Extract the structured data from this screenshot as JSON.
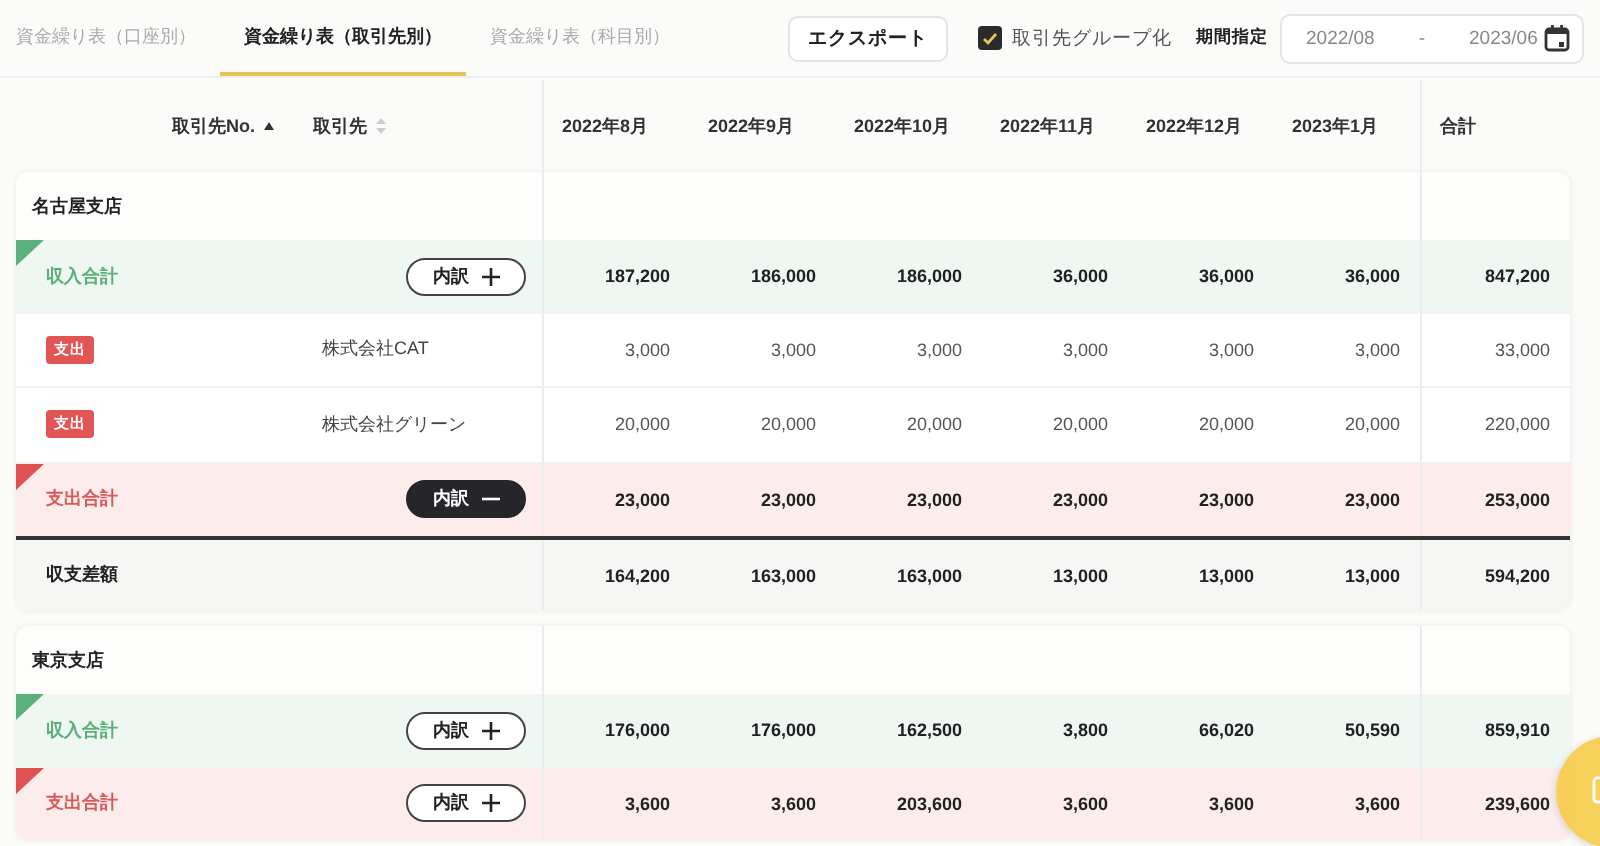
{
  "tabs": [
    {
      "label": "資金繰り表（口座別）",
      "selected": false
    },
    {
      "label": "資金繰り表（取引先別）",
      "selected": true
    },
    {
      "label": "資金繰り表（科目別）",
      "selected": false
    }
  ],
  "toolbar": {
    "export_button": "エクスポート",
    "group_checkbox": {
      "label": "取引先グループ化",
      "checked": true
    },
    "period": {
      "label": "期間指定",
      "start": "2022/08",
      "separator": "-",
      "end": "2023/06"
    }
  },
  "table_header": {
    "columns": [
      {
        "label": "取引先No.",
        "sorted": true
      },
      {
        "label": "取引先",
        "sorted": false
      }
    ],
    "months": [
      "2022年8月",
      "2022年9月",
      "2022年10月",
      "2022年11月",
      "2022年12月",
      "2023年1月"
    ],
    "total": "合計"
  },
  "groups": [
    {
      "name": "名古屋支店",
      "rows": [
        {
          "kind": "income_total",
          "label": "収入合計",
          "button": "内訳",
          "expanded": false,
          "values": [
            "187,200",
            "186,000",
            "186,000",
            "36,000",
            "36,000",
            "36,000"
          ],
          "total": "847,200"
        },
        {
          "kind": "expense",
          "badge": "支出",
          "partner": "株式会社CAT",
          "values": [
            "3,000",
            "3,000",
            "3,000",
            "3,000",
            "3,000",
            "3,000"
          ],
          "total": "33,000"
        },
        {
          "kind": "expense",
          "badge": "支出",
          "partner": "株式会社グリーン",
          "values": [
            "20,000",
            "20,000",
            "20,000",
            "20,000",
            "20,000",
            "20,000"
          ],
          "total": "220,000"
        },
        {
          "kind": "expense_total",
          "label": "支出合計",
          "button": "内訳",
          "expanded": true,
          "values": [
            "23,000",
            "23,000",
            "23,000",
            "23,000",
            "23,000",
            "23,000"
          ],
          "total": "253,000"
        },
        {
          "kind": "balance",
          "label": "収支差額",
          "values": [
            "164,200",
            "163,000",
            "163,000",
            "13,000",
            "13,000",
            "13,000"
          ],
          "total": "594,200"
        }
      ]
    },
    {
      "name": "東京支店",
      "rows": [
        {
          "kind": "income_total",
          "label": "収入合計",
          "button": "内訳",
          "expanded": false,
          "values": [
            "176,000",
            "176,000",
            "162,500",
            "3,800",
            "66,020",
            "50,590"
          ],
          "total": "859,910"
        },
        {
          "kind": "expense_total",
          "label": "支出合計",
          "button": "内訳",
          "expanded": false,
          "values": [
            "3,600",
            "3,600",
            "203,600",
            "3,600",
            "3,600",
            "3,600"
          ],
          "total": "239,600"
        }
      ]
    }
  ]
}
